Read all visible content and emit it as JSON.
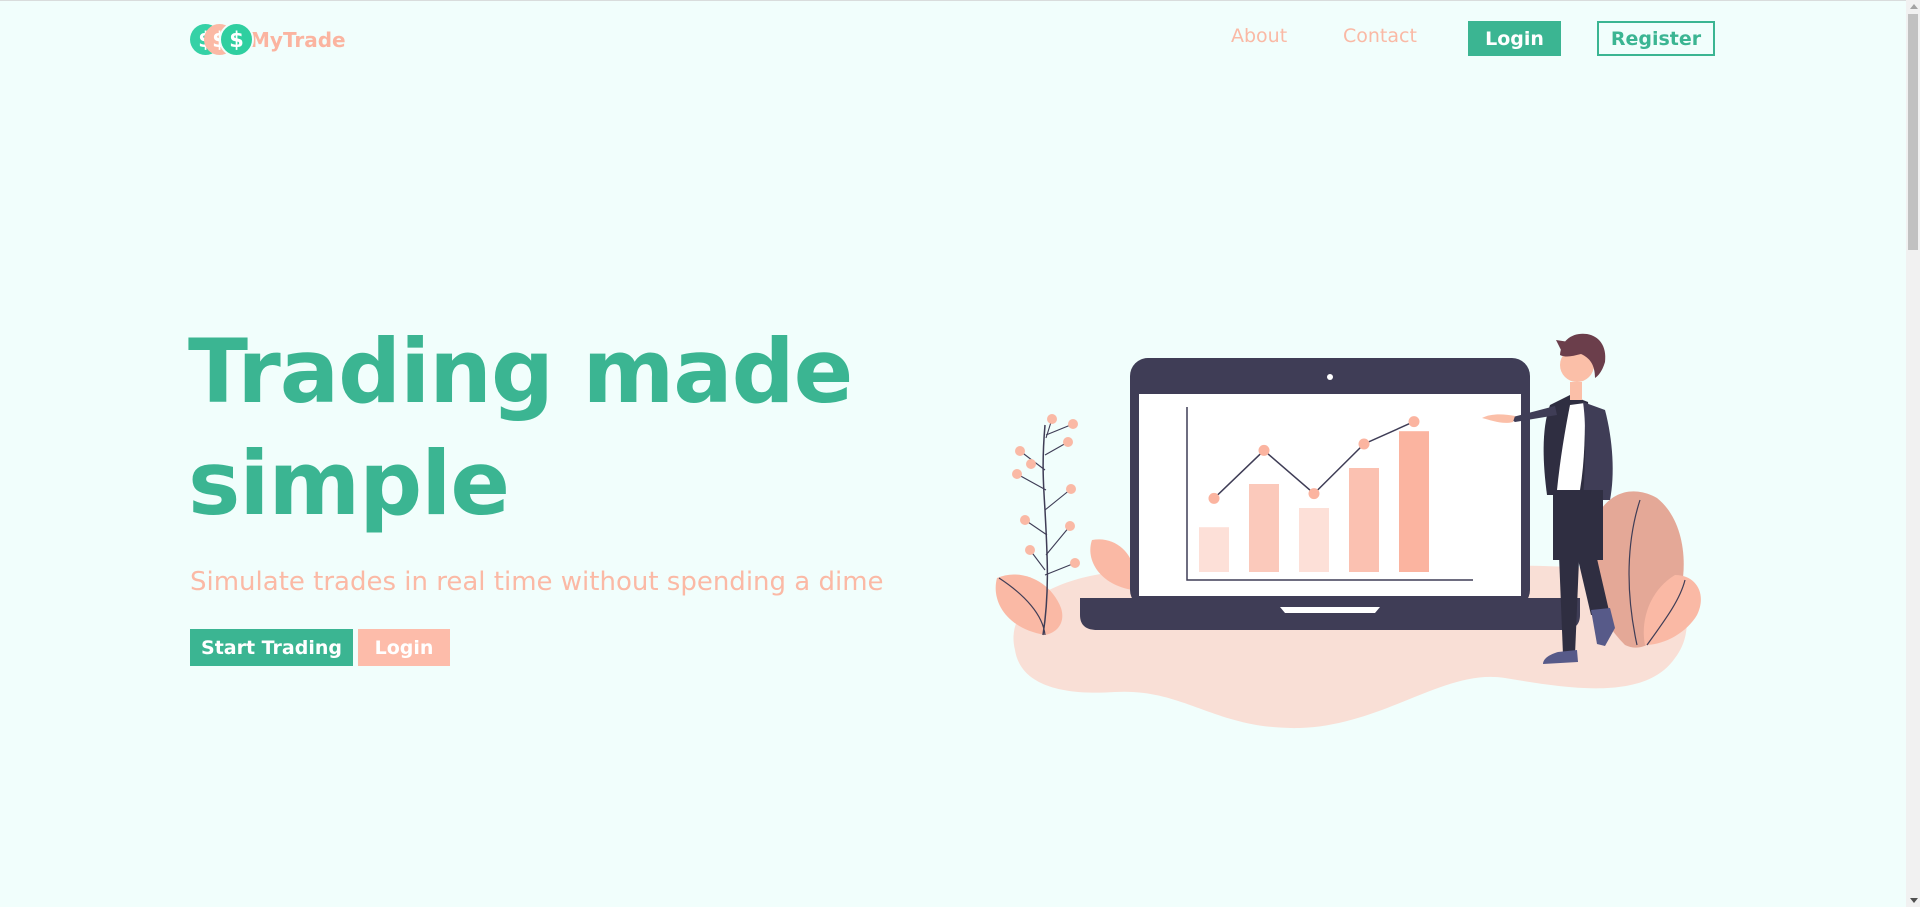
{
  "brand": {
    "name": "MyTrade",
    "icon": "dollar-coins-icon",
    "coin_glyph": "$"
  },
  "nav": {
    "about": "About",
    "contact": "Contact",
    "login": "Login",
    "register": "Register"
  },
  "hero": {
    "title": "Trading made simple",
    "subtitle": "Simulate trades in real time without spending a dime",
    "start_button": "Start Trading",
    "login_button": "Login"
  },
  "illustration": {
    "icon": "person-presenting-chart-on-laptop-illustration",
    "chart_bars": [
      0.28,
      0.55,
      0.4,
      0.65,
      0.88
    ],
    "chart_line": [
      0.46,
      0.76,
      0.49,
      0.8,
      0.94
    ]
  },
  "colors": {
    "primary": "#3bb592",
    "accent": "#fbb9a5",
    "background": "#f1fefc",
    "laptop": "#3f3d56"
  }
}
